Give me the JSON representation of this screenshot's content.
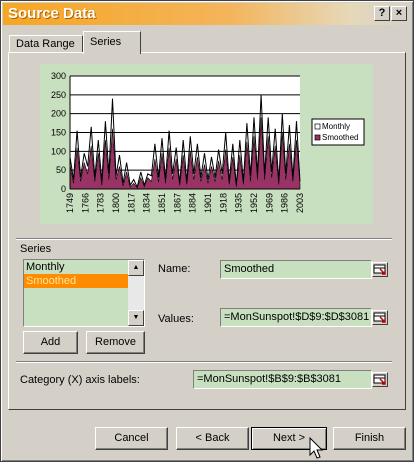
{
  "window": {
    "title": "Source Data",
    "help_label": "?",
    "close_label": "×"
  },
  "tabs": [
    {
      "label": "Data Range",
      "active": false
    },
    {
      "label": "Series",
      "active": true
    }
  ],
  "chart_data": {
    "type": "line",
    "title": "",
    "ylim": [
      0,
      300
    ],
    "yticks": [
      0,
      50,
      100,
      150,
      200,
      250,
      300
    ],
    "xticks": [
      "1749",
      "1766",
      "1783",
      "1800",
      "1817",
      "1834",
      "1851",
      "1867",
      "1884",
      "1901",
      "1918",
      "1935",
      "1952",
      "1969",
      "1986",
      "2003"
    ],
    "legend_position": "right",
    "grid": true,
    "series": [
      {
        "name": "Monthly",
        "color": "#000000",
        "fill": false,
        "values": [
          85,
          25,
          155,
          30,
          95,
          60,
          165,
          30,
          130,
          20,
          180,
          40,
          240,
          35,
          90,
          15,
          70,
          10,
          25,
          5,
          45,
          10,
          40,
          35,
          120,
          30,
          135,
          25,
          155,
          40,
          110,
          15,
          130,
          20,
          140,
          40,
          120,
          30,
          95,
          25,
          85,
          30,
          105,
          40,
          150,
          20,
          120,
          10,
          130,
          20,
          175,
          35,
          190,
          40,
          250,
          40,
          190,
          45,
          160,
          20,
          200,
          40,
          170,
          30,
          180,
          20
        ]
      },
      {
        "name": "Smoothed",
        "color": "#993366",
        "fill": true,
        "values": [
          65,
          15,
          110,
          20,
          70,
          40,
          115,
          20,
          95,
          10,
          130,
          25,
          160,
          25,
          60,
          8,
          45,
          5,
          15,
          3,
          30,
          6,
          30,
          20,
          80,
          18,
          95,
          15,
          110,
          25,
          80,
          10,
          90,
          12,
          100,
          25,
          85,
          20,
          65,
          15,
          60,
          20,
          75,
          25,
          105,
          12,
          85,
          6,
          90,
          12,
          125,
          20,
          140,
          25,
          190,
          25,
          140,
          30,
          115,
          12,
          150,
          25,
          120,
          20,
          130,
          12
        ]
      }
    ]
  },
  "series_section": {
    "label": "Series",
    "items": [
      "Monthly",
      "Smoothed"
    ],
    "selected": "Smoothed"
  },
  "buttons": {
    "add": "Add",
    "remove": "Remove",
    "cancel": "Cancel",
    "back": "< Back",
    "next": "Next >",
    "finish": "Finish"
  },
  "fields": {
    "name_label": "Name:",
    "name_value": "Smoothed",
    "values_label": "Values:",
    "values_value": "=MonSunspot!$D$9:$D$3081",
    "category_label": "Category (X) axis labels:",
    "category_value": "=MonSunspot!$B$9:$B$3081"
  }
}
